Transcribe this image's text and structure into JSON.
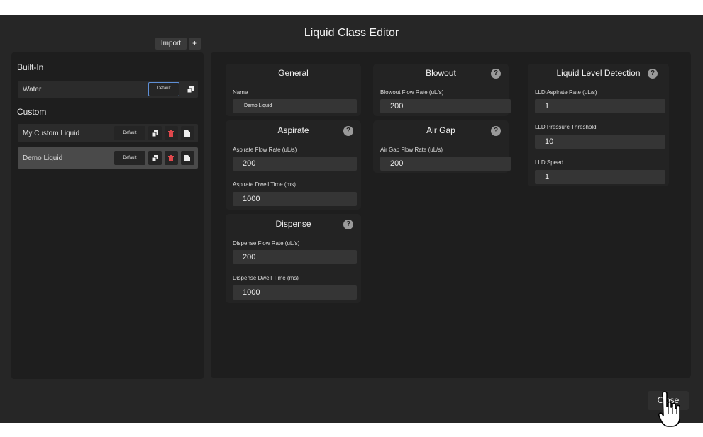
{
  "window": {
    "title": "Liquid Class Editor"
  },
  "toolbar": {
    "import_label": "Import",
    "add_label": "+"
  },
  "sidebar": {
    "builtin_heading": "Built-In",
    "custom_heading": "Custom",
    "builtin_items": [
      {
        "label": "Water",
        "default_label": "Default"
      }
    ],
    "custom_items": [
      {
        "label": "My Custom Liquid",
        "default_label": "Default"
      },
      {
        "label": "Demo Liquid",
        "default_label": "Default"
      }
    ]
  },
  "general": {
    "title": "General",
    "name_label": "Name",
    "name_value": "Demo Liquid"
  },
  "aspirate": {
    "title": "Aspirate",
    "flow_rate_label": "Aspirate Flow Rate (uL/s)",
    "flow_rate_value": "200",
    "dwell_label": "Aspirate Dwell Time (ms)",
    "dwell_value": "1000"
  },
  "dispense": {
    "title": "Dispense",
    "flow_rate_label": "Dispense Flow Rate (uL/s)",
    "flow_rate_value": "200",
    "dwell_label": "Dispense Dwell Time (ms)",
    "dwell_value": "1000"
  },
  "blowout": {
    "title": "Blowout",
    "flow_rate_label": "Blowout Flow Rate (uL/s)",
    "flow_rate_value": "200"
  },
  "airgap": {
    "title": "Air Gap",
    "flow_rate_label": "Air Gap Flow Rate (uL/s)",
    "flow_rate_value": "200"
  },
  "lld": {
    "title": "Liquid Level Detection",
    "aspirate_rate_label": "LLD Aspirate Rate (uL/s)",
    "aspirate_rate_value": "1",
    "pressure_label": "LLD Pressure Threshold",
    "pressure_value": "10",
    "speed_label": "LLD Speed",
    "speed_value": "1"
  },
  "help_glyph": "?",
  "footer": {
    "close_label": "Close"
  },
  "colors": {
    "accent": "#5e8fd6",
    "delete": "#e0484c",
    "selected_row": "#4a4a4a"
  }
}
